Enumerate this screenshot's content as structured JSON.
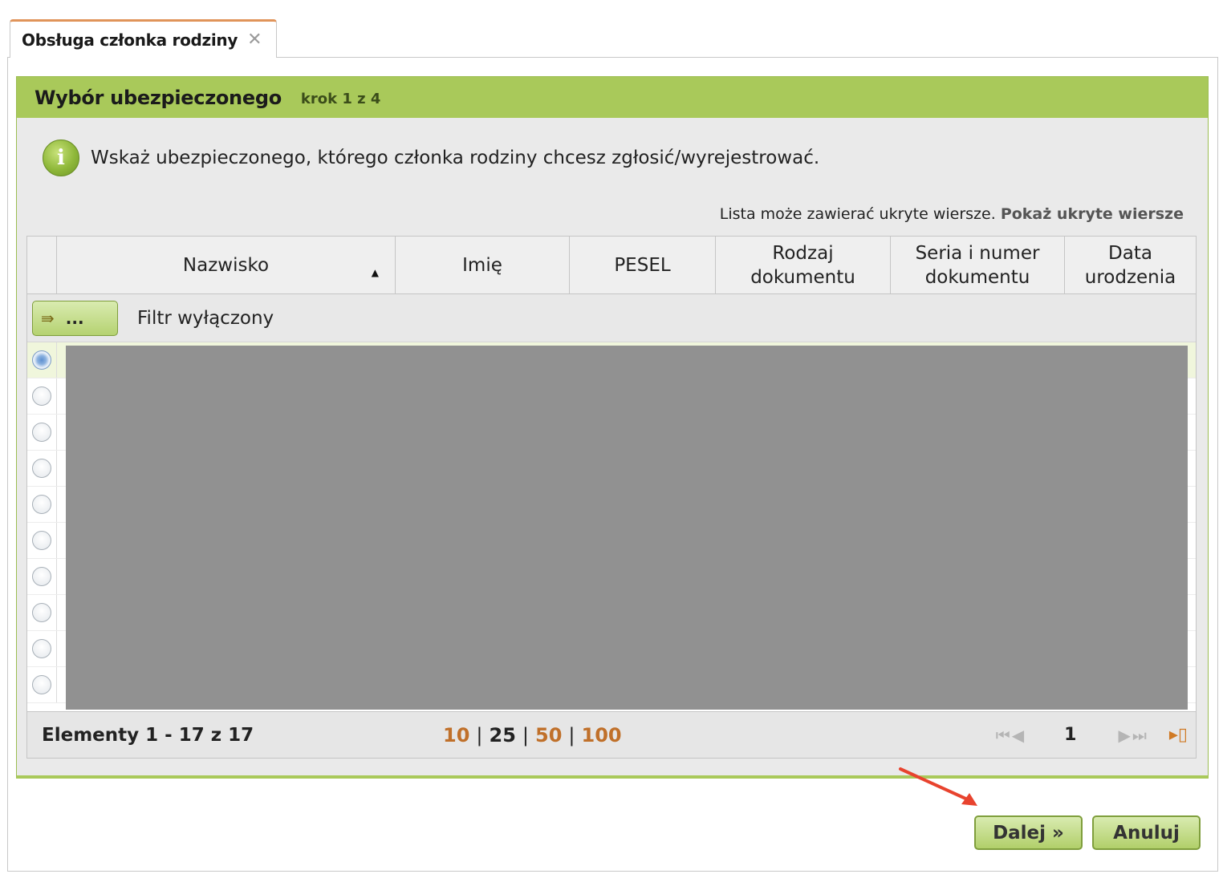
{
  "tab": {
    "label": "Obsługa członka rodziny",
    "close_glyph": "✕"
  },
  "panel": {
    "title": "Wybór ubezpieczonego",
    "step": "krok 1 z 4"
  },
  "info": {
    "text": "Wskaż ubezpieczonego, którego członka rodziny chcesz zgłosić/wyrejestrować."
  },
  "hidden_rows": {
    "text": "Lista może zawierać ukryte wiersze.",
    "link": "Pokaż ukryte wiersze"
  },
  "grid": {
    "columns": [
      "Nazwisko",
      "Imię",
      "PESEL",
      "Rodzaj dokumentu",
      "Seria i numer dokumentu",
      "Data urodzenia"
    ],
    "sorted_column": "Nazwisko",
    "sort_direction": "ascending",
    "filter_button": "...",
    "filter_label": "Filtr wyłączony",
    "visible_row_count": 10,
    "selected_row_index": 0,
    "rows_redacted": true
  },
  "footer": {
    "count_text": "Elementy 1 - 17 z 17",
    "page_sizes": [
      "10",
      "25",
      "50",
      "100"
    ],
    "current_page_size": "25",
    "page": "1"
  },
  "buttons": {
    "next": "Dalej »",
    "cancel": "Anuluj"
  },
  "colors": {
    "header_green": "#a9c95a",
    "tab_accent": "#e0945a",
    "link_orange": "#c0702a",
    "annotation_arrow": "#e8432e",
    "redaction_gray": "#919191"
  }
}
